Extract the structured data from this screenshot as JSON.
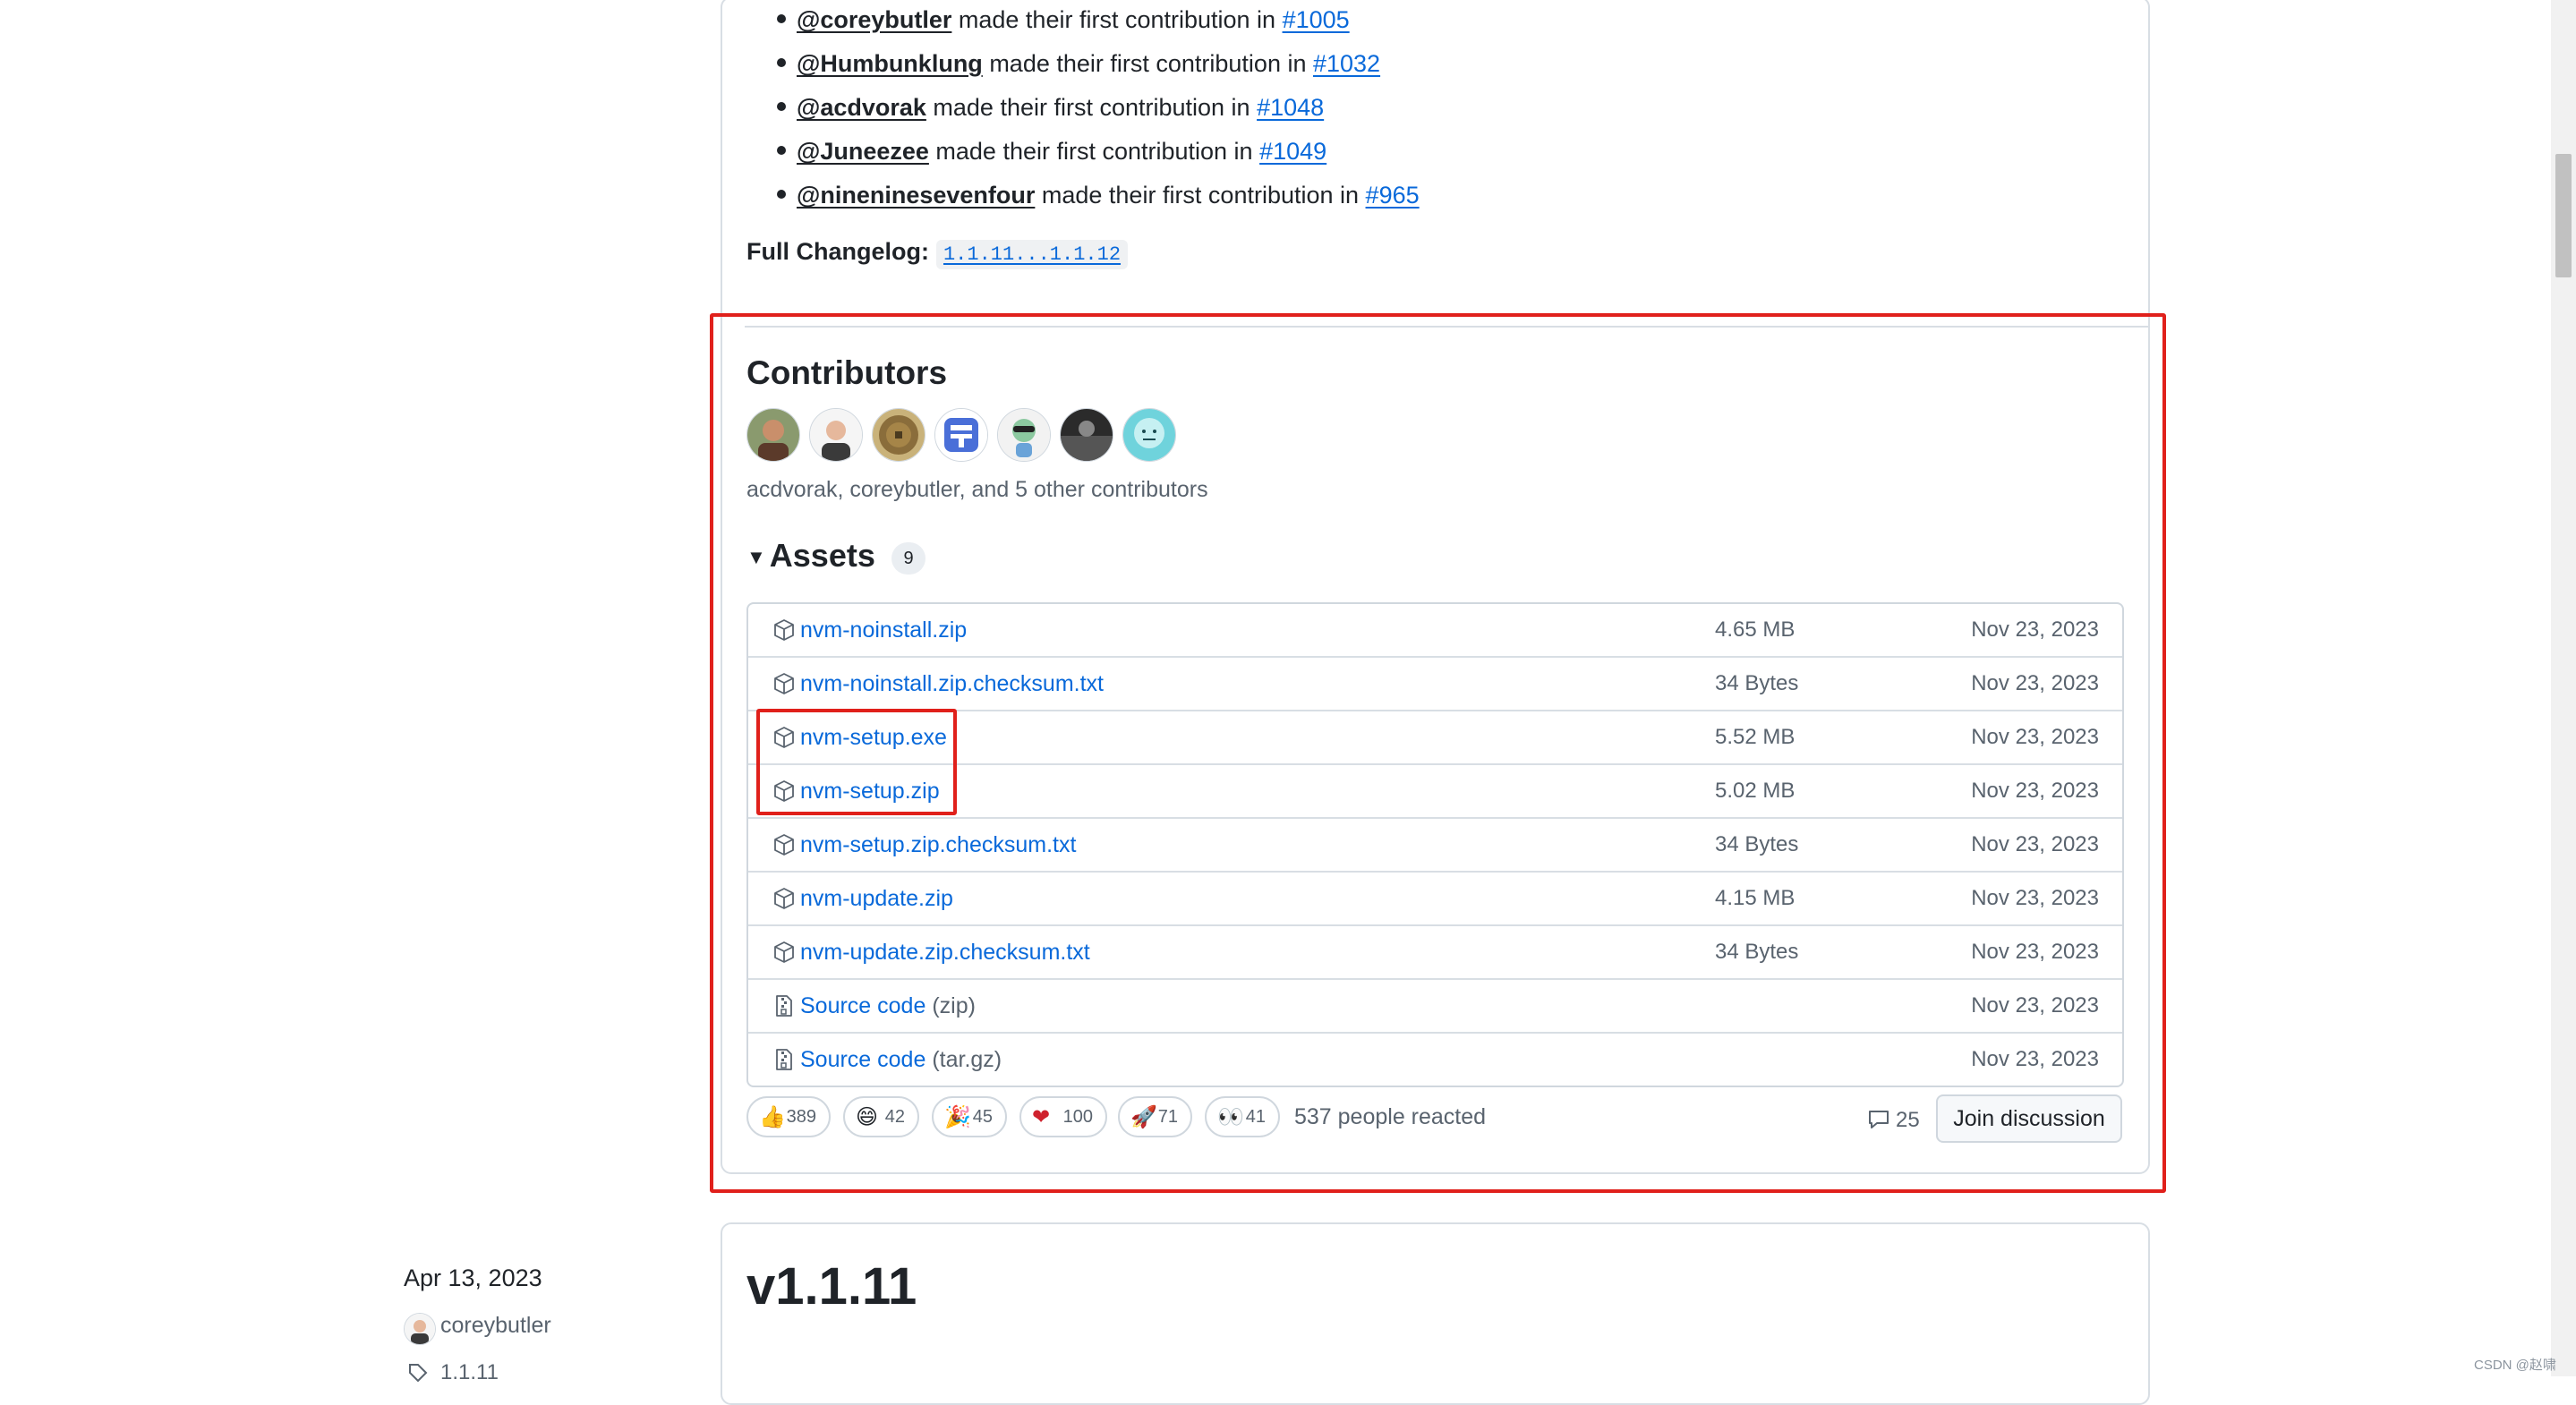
{
  "first_contributions": [
    {
      "user": "@coreybutler",
      "text": " made their first contribution in ",
      "pr": "#1005"
    },
    {
      "user": "@Humbunklung",
      "text": " made their first contribution in ",
      "pr": "#1032"
    },
    {
      "user": "@acdvorak",
      "text": " made their first contribution in ",
      "pr": "#1048"
    },
    {
      "user": "@Juneezee",
      "text": " made their first contribution in ",
      "pr": "#1049"
    },
    {
      "user": "@nineninesevenfour",
      "text": " made their first contribution in ",
      "pr": "#965"
    }
  ],
  "changelog": {
    "label": "Full Changelog:",
    "link": "1.1.11...1.1.12"
  },
  "contributors": {
    "title": "Contributors",
    "summary": "acdvorak, coreybutler, and 5 other contributors"
  },
  "assets": {
    "title": "Assets",
    "count": "9",
    "rows": [
      {
        "name": "nvm-noinstall.zip",
        "ext": "",
        "size": "4.65 MB",
        "date": "Nov 23, 2023",
        "icon": "package-icon"
      },
      {
        "name": "nvm-noinstall.zip.checksum.txt",
        "ext": "",
        "size": "34 Bytes",
        "date": "Nov 23, 2023",
        "icon": "package-icon"
      },
      {
        "name": "nvm-setup.exe",
        "ext": "",
        "size": "5.52 MB",
        "date": "Nov 23, 2023",
        "icon": "package-icon"
      },
      {
        "name": "nvm-setup.zip",
        "ext": "",
        "size": "5.02 MB",
        "date": "Nov 23, 2023",
        "icon": "package-icon"
      },
      {
        "name": "nvm-setup.zip.checksum.txt",
        "ext": "",
        "size": "34 Bytes",
        "date": "Nov 23, 2023",
        "icon": "package-icon"
      },
      {
        "name": "nvm-update.zip",
        "ext": "",
        "size": "4.15 MB",
        "date": "Nov 23, 2023",
        "icon": "package-icon"
      },
      {
        "name": "nvm-update.zip.checksum.txt",
        "ext": "",
        "size": "34 Bytes",
        "date": "Nov 23, 2023",
        "icon": "package-icon"
      },
      {
        "name": "Source code",
        "ext": " (zip)",
        "size": "",
        "date": "Nov 23, 2023",
        "icon": "file-zip-icon"
      },
      {
        "name": "Source code",
        "ext": " (tar.gz)",
        "size": "",
        "date": "Nov 23, 2023",
        "icon": "file-zip-icon"
      }
    ]
  },
  "reactions": [
    {
      "emoji": "👍",
      "name": "thumbs-up",
      "count": "389"
    },
    {
      "emoji": "😄",
      "name": "laugh",
      "count": "42"
    },
    {
      "emoji": "🎉",
      "name": "hooray",
      "count": "45"
    },
    {
      "emoji": "❤",
      "name": "heart",
      "count": "100"
    },
    {
      "emoji": "🚀",
      "name": "rocket",
      "count": "71"
    },
    {
      "emoji": "👀",
      "name": "eyes",
      "count": "41"
    }
  ],
  "reactions_summary": "537 people reacted",
  "discussion": {
    "comments": "25",
    "join_label": "Join discussion"
  },
  "next_release": {
    "date": "Apr 13, 2023",
    "author": "coreybutler",
    "tag": "1.1.11",
    "title": "v1.1.11"
  },
  "watermark": "CSDN @赵啸",
  "colors": {
    "link": "#0969da",
    "highlight": "#e0201b",
    "muted": "#59636e"
  }
}
